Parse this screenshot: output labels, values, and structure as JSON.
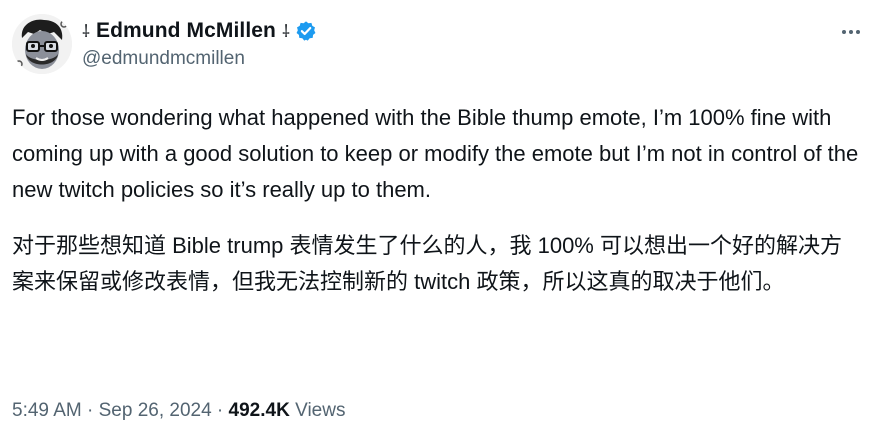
{
  "author": {
    "name": "Edmund McMillen",
    "name_prefix_symbol": "⸸",
    "name_suffix_symbol": "⸸",
    "handle": "@edmundmcmillen",
    "verified_color": "#1d9bf0"
  },
  "tweet": {
    "text_en": "For those wondering what happened with the Bible thump emote, I’m 100% fine with coming up with a good solution to keep or modify the emote but I’m not in control of the new twitch policies so it’s really up to them.",
    "text_zh": "对于那些想知道 Bible trump 表情发生了什么的人，我 100% 可以想出一个好的解决方案来保留或修改表情，但我无法控制新的 twitch 政策，所以这真的取决于他们。"
  },
  "meta": {
    "time": "5:49 AM",
    "separator": " · ",
    "date": "Sep 26, 2024",
    "views_count": "492.4K",
    "views_label": "Views"
  },
  "icons": {
    "more": "more-dots-icon",
    "verified": "verified-badge-icon",
    "avatar": "avatar-image"
  }
}
